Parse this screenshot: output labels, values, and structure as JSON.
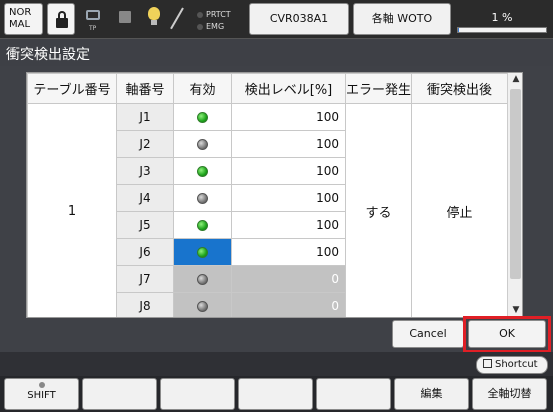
{
  "topbar": {
    "mode_line1": "NOR",
    "mode_line2": "MAL",
    "tp_label": "TP",
    "status_prtct": "PRTCT",
    "status_emg": "EMG",
    "robot_name": "CVR038A1",
    "axis_mode": "各軸 WOTO",
    "speed_label": "1 %",
    "speed_percent": 1
  },
  "title": "衝突検出設定",
  "table": {
    "headers": [
      "テーブル番号",
      "軸番号",
      "有効",
      "検出レベル[%]",
      "エラー発生",
      "衝突検出後"
    ],
    "table_number": "1",
    "error_occurrence": "する",
    "after_detection": "停止",
    "rows": [
      {
        "axis": "J1",
        "enabled": true,
        "level": "100",
        "disabled": false,
        "selected": false
      },
      {
        "axis": "J2",
        "enabled": false,
        "level": "100",
        "disabled": false,
        "selected": false
      },
      {
        "axis": "J3",
        "enabled": true,
        "level": "100",
        "disabled": false,
        "selected": false
      },
      {
        "axis": "J4",
        "enabled": false,
        "level": "100",
        "disabled": false,
        "selected": false
      },
      {
        "axis": "J5",
        "enabled": true,
        "level": "100",
        "disabled": false,
        "selected": false
      },
      {
        "axis": "J6",
        "enabled": true,
        "level": "100",
        "disabled": false,
        "selected": true
      },
      {
        "axis": "J7",
        "enabled": false,
        "level": "0",
        "disabled": true,
        "selected": false
      },
      {
        "axis": "J8",
        "enabled": false,
        "level": "0",
        "disabled": true,
        "selected": false
      }
    ]
  },
  "actions": {
    "cancel": "Cancel",
    "ok": "OK",
    "shortcut": "Shortcut"
  },
  "fkeys": [
    "SHIFT",
    "",
    "",
    "",
    "",
    "編集",
    "全軸切替"
  ],
  "colors": {
    "highlight": "#e01f26",
    "selected_cell": "#1874cd",
    "enabled_led": "#1ea51c",
    "disabled_led": "#7a7a7a"
  }
}
